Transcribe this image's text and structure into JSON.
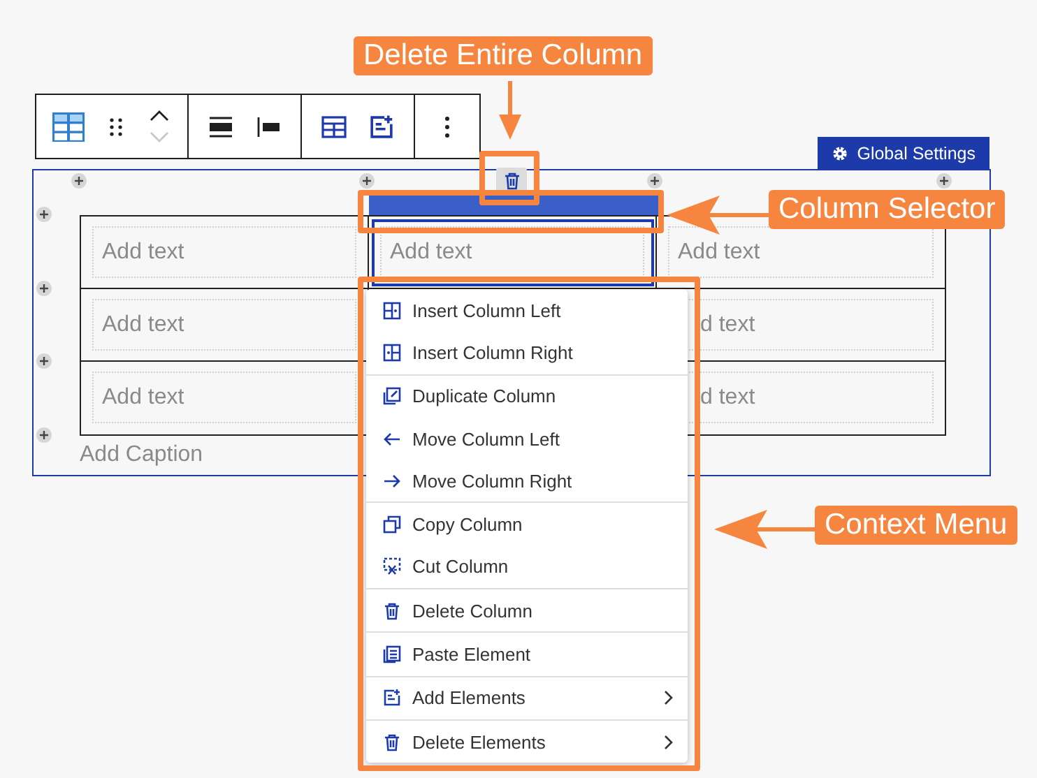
{
  "toolbar": [
    [
      {
        "kind": "table-block"
      },
      {
        "kind": "drag"
      },
      {
        "kind": "move-up",
        "disabled": false
      },
      {
        "kind": "move-down",
        "disabled": true
      }
    ],
    [
      {
        "kind": "align-wide"
      },
      {
        "kind": "align-left"
      }
    ],
    [
      {
        "kind": "table-edit"
      },
      {
        "kind": "add-element"
      }
    ],
    [
      {
        "kind": "more"
      }
    ]
  ],
  "global_settings": "Global Settings",
  "columns": [
    {
      "selected": false
    },
    {
      "selected": true
    },
    {
      "selected": false
    }
  ],
  "rows": [
    [
      {
        "kind": "field",
        "placeholder": "Add text"
      },
      {
        "kind": "field",
        "placeholder": "Add text"
      },
      {
        "kind": "field",
        "placeholder": "Add text"
      }
    ],
    [
      {
        "kind": "field",
        "placeholder": "Add text"
      },
      {
        "kind": "hidden"
      },
      {
        "kind": "covered",
        "placeholder": "d text"
      }
    ],
    [
      {
        "kind": "field",
        "placeholder": "Add text"
      },
      {
        "kind": "hidden"
      },
      {
        "kind": "covered",
        "placeholder": "d text"
      }
    ]
  ],
  "caption_placeholder": "Add Caption",
  "context_menu": [
    [
      {
        "kind": "insert-left",
        "label": "Insert Column Left",
        "submenu": false
      },
      {
        "kind": "insert-right",
        "label": "Insert Column Right",
        "submenu": false
      }
    ],
    [
      {
        "kind": "duplicate",
        "label": "Duplicate Column",
        "submenu": false
      },
      {
        "kind": "move-left",
        "label": "Move Column Left",
        "submenu": false
      },
      {
        "kind": "move-right",
        "label": "Move Column Right",
        "submenu": false
      }
    ],
    [
      {
        "kind": "copy",
        "label": "Copy Column",
        "submenu": false
      },
      {
        "kind": "cut",
        "label": "Cut Column",
        "submenu": false
      }
    ],
    [
      {
        "kind": "delete",
        "label": "Delete Column",
        "submenu": false
      }
    ],
    [
      {
        "kind": "paste",
        "label": "Paste Element",
        "submenu": false
      }
    ],
    [
      {
        "kind": "add",
        "label": "Add Elements",
        "submenu": true
      }
    ],
    [
      {
        "kind": "delete",
        "label": "Delete Elements",
        "submenu": true
      }
    ]
  ],
  "callouts": [
    {
      "kind": "delete",
      "text": "Delete Entire Column"
    },
    {
      "kind": "selector",
      "text": "Column Selector"
    },
    {
      "kind": "menu",
      "text": "Context Menu"
    }
  ]
}
